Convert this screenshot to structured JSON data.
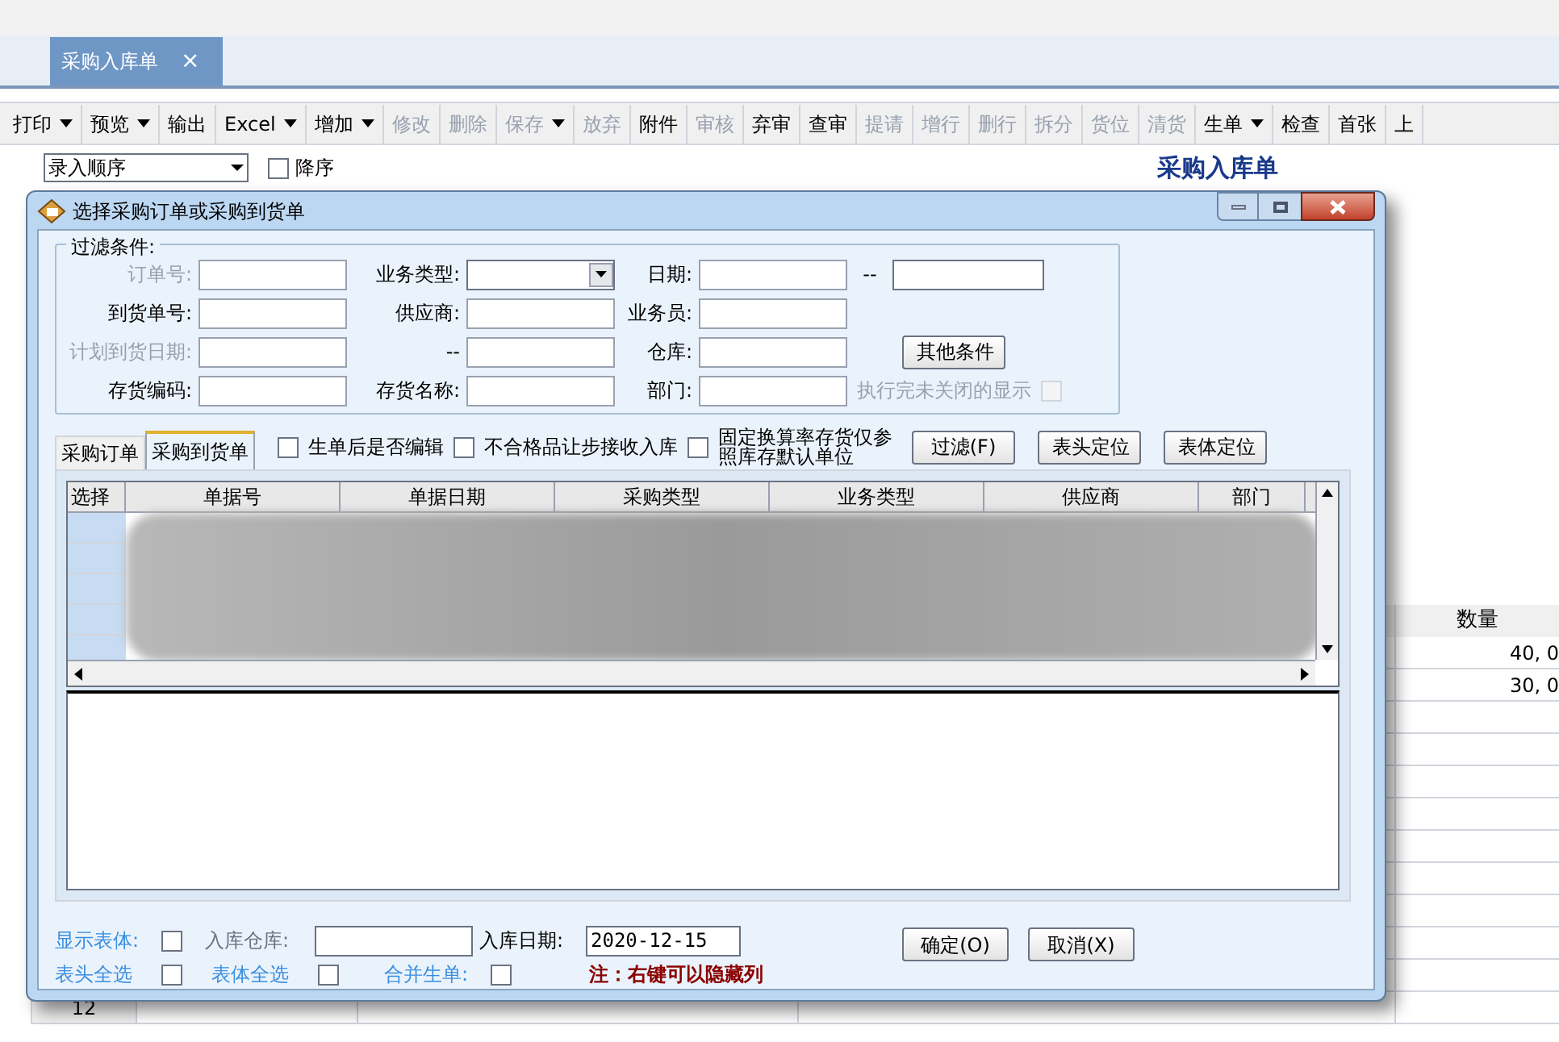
{
  "document_tab": {
    "label": "采购入库单",
    "close": "×"
  },
  "toolbar": [
    {
      "label": "打印",
      "dropdown": true,
      "disabled": false
    },
    {
      "label": "预览",
      "dropdown": true,
      "disabled": false
    },
    {
      "label": "输出",
      "dropdown": false,
      "disabled": false
    },
    {
      "label": "Excel",
      "dropdown": true,
      "disabled": false
    },
    {
      "label": "增加",
      "dropdown": true,
      "disabled": false
    },
    {
      "label": "修改",
      "dropdown": false,
      "disabled": true
    },
    {
      "label": "删除",
      "dropdown": false,
      "disabled": true
    },
    {
      "label": "保存",
      "dropdown": true,
      "disabled": true
    },
    {
      "label": "放弃",
      "dropdown": false,
      "disabled": true
    },
    {
      "label": "附件",
      "dropdown": false,
      "disabled": false
    },
    {
      "label": "审核",
      "dropdown": false,
      "disabled": true
    },
    {
      "label": "弃审",
      "dropdown": false,
      "disabled": false
    },
    {
      "label": "查审",
      "dropdown": false,
      "disabled": false
    },
    {
      "label": "提请",
      "dropdown": false,
      "disabled": true
    },
    {
      "label": "增行",
      "dropdown": false,
      "disabled": true
    },
    {
      "label": "删行",
      "dropdown": false,
      "disabled": true
    },
    {
      "label": "拆分",
      "dropdown": false,
      "disabled": true
    },
    {
      "label": "货位",
      "dropdown": false,
      "disabled": true
    },
    {
      "label": "清货",
      "dropdown": false,
      "disabled": true
    },
    {
      "label": "生单",
      "dropdown": true,
      "disabled": false
    },
    {
      "label": "检查",
      "dropdown": false,
      "disabled": false
    },
    {
      "label": "首张",
      "dropdown": false,
      "disabled": false
    },
    {
      "label": "上",
      "dropdown": false,
      "disabled": false
    }
  ],
  "sort": {
    "value": "录入顺序",
    "descending": {
      "label": "降序",
      "checked": false
    }
  },
  "page_title": "采购入库单",
  "background_grid": {
    "columns": [
      "数量"
    ],
    "rows": [
      {
        "quantity": "40, 0"
      },
      {
        "quantity": "30, 0"
      },
      {},
      {},
      {},
      {},
      {},
      {},
      {},
      {},
      {},
      {
        "number": "12"
      }
    ]
  },
  "dialog": {
    "title": "选择采购订单或采购到货单",
    "filter": {
      "title": "过滤条件:",
      "rows": [
        [
          {
            "label": "订单号:",
            "kind": "input",
            "disabled": true
          },
          {
            "label": "业务类型:",
            "kind": "select",
            "disabled": false
          },
          {
            "label": "日期:",
            "kind": "range",
            "separator": "--",
            "disabled": false
          }
        ],
        [
          {
            "label": "到货单号:",
            "kind": "input",
            "disabled": false
          },
          {
            "label": "供应商:",
            "kind": "input",
            "disabled": false
          },
          {
            "label": "业务员:",
            "kind": "input",
            "disabled": false
          }
        ],
        [
          {
            "label": "计划到货日期:",
            "kind": "input",
            "disabled": true
          },
          {
            "label": "--",
            "kind": "input",
            "disabled": false
          },
          {
            "label": "仓库:",
            "kind": "input",
            "disabled": false
          }
        ],
        [
          {
            "label": "存货编码:",
            "kind": "input",
            "disabled": false
          },
          {
            "label": "存货名称:",
            "kind": "input",
            "disabled": false
          },
          {
            "label": "部门:",
            "kind": "input",
            "disabled": false
          }
        ]
      ],
      "other_button": "其他条件",
      "show_closed": {
        "label": "执行完未关闭的显示",
        "checked": false,
        "disabled": true
      }
    },
    "tabs": [
      {
        "label": "采购订单",
        "selected": false
      },
      {
        "label": "采购到货单",
        "selected": true
      }
    ],
    "options": [
      {
        "label": "生单后是否编辑",
        "checked": false
      },
      {
        "label": "不合格品让步接收入库",
        "checked": false
      },
      {
        "label": "固定换算率存货仅参照库存默认单位",
        "checked": false
      }
    ],
    "buttons": [
      "过滤(F)",
      "表头定位",
      "表体定位"
    ],
    "grid": {
      "columns": [
        "选择",
        "单据号",
        "单据日期",
        "采购类型",
        "业务类型",
        "供应商",
        "部门"
      ]
    },
    "footer": {
      "show_body": {
        "label": "显示表体:",
        "checked": false
      },
      "warehouse": {
        "label": "入库仓库:"
      },
      "date": {
        "label": "入库日期:",
        "value": "2020-12-15"
      },
      "select_options": [
        {
          "label": "表头全选",
          "checked": false
        },
        {
          "label": "表体全选",
          "checked": false
        },
        {
          "label": "合并生单:",
          "checked": false
        }
      ],
      "note": "注：右键可以隐藏列",
      "buttons": [
        "确定(O)",
        "取消(X)"
      ]
    }
  }
}
